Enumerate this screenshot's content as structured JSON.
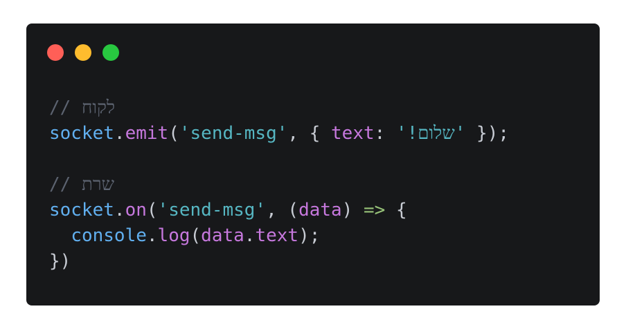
{
  "window": {
    "background": "#17181a",
    "dots": [
      {
        "name": "close",
        "color": "#ff5f57"
      },
      {
        "name": "minimize",
        "color": "#febc2e"
      },
      {
        "name": "maximize",
        "color": "#28c840"
      }
    ]
  },
  "code": {
    "colors": {
      "comment": "#5c6370",
      "identifier": "#61afef",
      "property": "#c678dd",
      "string": "#56b6c2",
      "arrow": "#98c379",
      "punctuation": "#c8ccd4"
    },
    "line1": {
      "comment_prefix": "// ",
      "comment_text": "לקוח"
    },
    "line2": {
      "obj": "socket",
      "dot": ".",
      "method": "emit",
      "open": "(",
      "event": "'send-msg'",
      "sep": ", { ",
      "key": "text",
      "colon": ": ",
      "q1": "'",
      "msg_text": "שלום!",
      "q2": "'",
      "close": " });"
    },
    "line4": {
      "comment_prefix": "// ",
      "comment_text": "שרת"
    },
    "line5": {
      "obj": "socket",
      "dot": ".",
      "method": "on",
      "open": "(",
      "event": "'send-msg'",
      "sep": ", (",
      "param": "data",
      "paren_close": ") ",
      "arrow": "=>",
      "brace": " {"
    },
    "line6": {
      "indent": "  ",
      "obj": "console",
      "dot": ".",
      "method": "log",
      "open": "(",
      "arg_obj": "data",
      "arg_dot": ".",
      "arg_prop": "text",
      "close": ");"
    },
    "line7": {
      "close": "})"
    }
  }
}
